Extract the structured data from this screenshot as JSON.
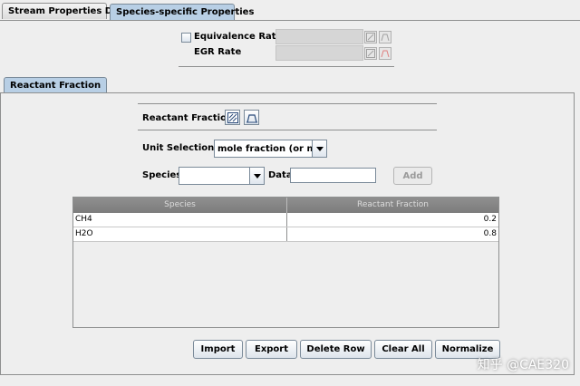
{
  "tabs": {
    "stream_properties": "Stream Properties Data",
    "species_specific": "Species-specific Properties"
  },
  "top_section": {
    "equivalence_ratio_label": "Equivalence Ratio",
    "egr_rate_label": "EGR Rate",
    "equivalence_ratio_checked": false
  },
  "inner_tab": {
    "label": "Reactant Fraction"
  },
  "reactant_section": {
    "title": "Reactant Fraction",
    "unit_selection_label": "Unit Selection:",
    "unit_selection_value": "mole fraction (or mole)",
    "species_label": "Species",
    "species_value": "",
    "data_label": "Data",
    "data_value": "",
    "add_button": "Add"
  },
  "table": {
    "columns": [
      "Species",
      "Reactant Fraction"
    ],
    "rows": [
      {
        "species": "CH4",
        "fraction": "0.2"
      },
      {
        "species": "H2O",
        "fraction": "0.8"
      }
    ]
  },
  "buttons": {
    "import": "Import",
    "export": "Export",
    "delete_row": "Delete Row",
    "clear_all": "Clear All",
    "normalize": "Normalize"
  },
  "watermark": "知乎 @CAE320",
  "icons": [
    "grid-icon",
    "profile-icon"
  ]
}
